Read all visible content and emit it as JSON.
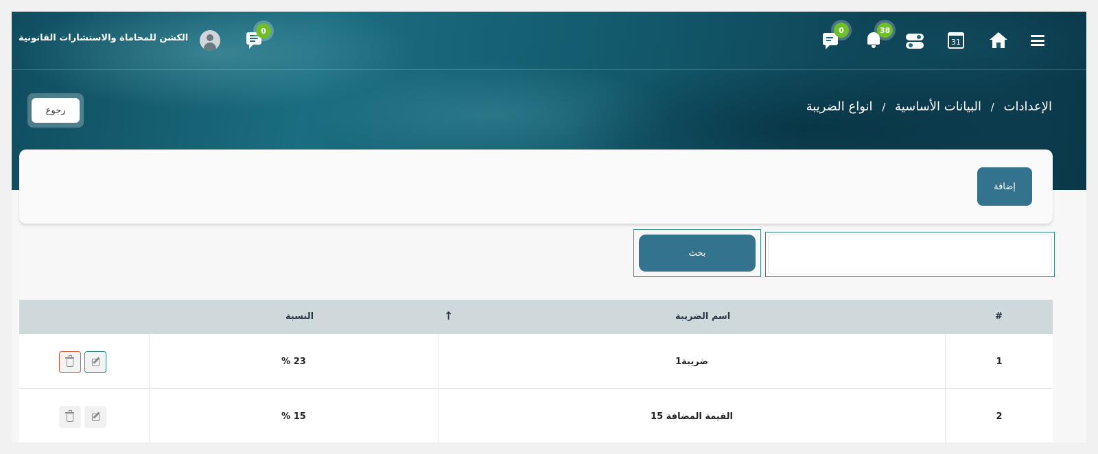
{
  "header": {
    "brand": "الكشن للمحاماة والاستشارات القانونية",
    "messages_badge": "0",
    "chat_badge": "0",
    "notifications_badge": "38",
    "calendar_day": "31"
  },
  "breadcrumb": {
    "items": [
      "الإعدادات",
      "البيانات الأساسية",
      "انواع الضريبة"
    ],
    "separator": "/"
  },
  "back_button": "رجوع",
  "add_button": "إضافة",
  "search": {
    "value": "",
    "button": "بحث"
  },
  "table": {
    "columns": [
      "#",
      "اسم الضريبة",
      "النسبة"
    ],
    "rows": [
      {
        "index": "1",
        "name": "ضريبة1",
        "rate": "% 23"
      },
      {
        "index": "2",
        "name": "القيمة المضافة 15",
        "rate": "% 15"
      }
    ]
  },
  "colors": {
    "primary": "#34738d",
    "badge": "#6fbf2a",
    "highlight": "#2a8a7c",
    "danger": "#e05a3a"
  }
}
